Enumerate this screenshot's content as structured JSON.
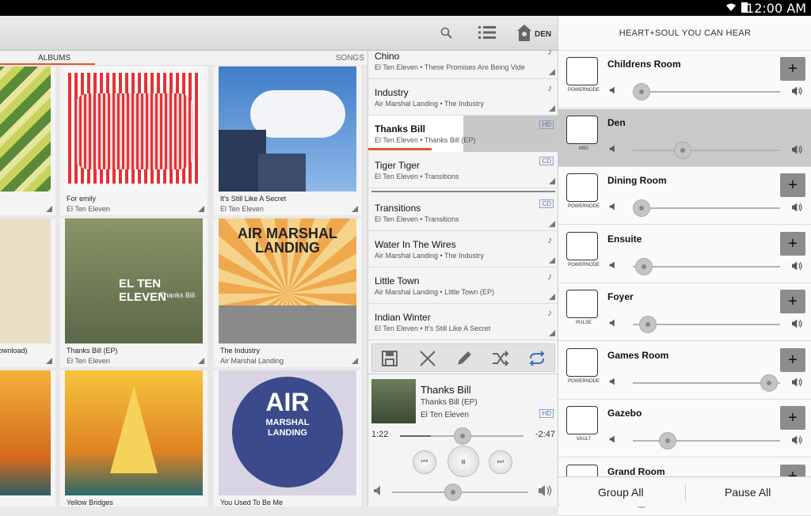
{
  "status": {
    "time": "12:00 AM"
  },
  "topbar": {
    "room_label": "DEN"
  },
  "albums": {
    "tabs": [
      "ALBUMS",
      "SONGS"
    ],
    "items": [
      {
        "title": "",
        "artist": ""
      },
      {
        "title": "For emily",
        "artist": "El Ten Eleven"
      },
      {
        "title": "It's Still Like A Secret",
        "artist": "El Ten Eleven"
      },
      {
        "title": "ownload)",
        "artist": ""
      },
      {
        "title": "Thanks Bill (EP)",
        "artist": "El Ten Eleven"
      },
      {
        "title": "The Industry",
        "artist": "Air Marshal Landing"
      },
      {
        "title": "",
        "artist": ""
      },
      {
        "title": "Yellow Bridges",
        "artist": ""
      },
      {
        "title": "You Used To Be Me",
        "artist": ""
      }
    ],
    "art_text": {
      "air_marshal": "AIR MARSHAL LANDING",
      "el_ten_eleven": "EL TEN ELEVEN",
      "thanks_bill": "Thanks Bill",
      "air_big": "AIR",
      "marshal_landing": "MARSHAL LANDING"
    }
  },
  "queue": {
    "items": [
      {
        "title": "Chino",
        "subtitle": "El Ten Eleven • These Promises Are Being Vide",
        "tag": "♪"
      },
      {
        "title": "Industry",
        "subtitle": "Air Marshal Landing • The Industry",
        "tag": "♪"
      },
      {
        "title": "Thanks Bill",
        "subtitle": "El Ten Eleven • Thanks Bill (EP)",
        "tag": "HD"
      },
      {
        "title": "Tiger Tiger",
        "subtitle": "El Ten Eleven • Transitions",
        "tag": "CD"
      },
      {
        "title": "Transitions",
        "subtitle": "El Ten Eleven • Transitions",
        "tag": "CD"
      },
      {
        "title": "Water In The Wires",
        "subtitle": "Air Marshal Landing • The Industry",
        "tag": "♪"
      },
      {
        "title": "Little Town",
        "subtitle": "Air Marshal Landing • Little Town (EP)",
        "tag": "♪"
      },
      {
        "title": "Indian Winter",
        "subtitle": "El Ten Eleven • It's Still Like A Secret",
        "tag": "♪"
      }
    ]
  },
  "now_playing": {
    "title": "Thanks Bill",
    "album": "Thanks Bill (EP)",
    "artist": "El Ten Eleven",
    "badge": "HD",
    "elapsed": "1:22",
    "remaining": "-2:47",
    "progress": 0.25,
    "volume": 0.27
  },
  "zones": {
    "header": "HEART+SOUL YOU CAN HEAR",
    "items": [
      {
        "name": "Childrens Room",
        "device": "POWERNODE",
        "volume": 0.0,
        "selected": false
      },
      {
        "name": "Den",
        "device": "M50",
        "volume": 0.32,
        "selected": true
      },
      {
        "name": "Dining Room",
        "device": "POWERNODE",
        "volume": 0.0,
        "selected": false
      },
      {
        "name": "Ensuite",
        "device": "POWERNODE",
        "volume": 0.02,
        "selected": false
      },
      {
        "name": "Foyer",
        "device": "PULSE",
        "volume": 0.05,
        "selected": false
      },
      {
        "name": "Games Room",
        "device": "POWERNODE",
        "volume": 0.98,
        "selected": false
      },
      {
        "name": "Gazebo",
        "device": "VAULT",
        "volume": 0.2,
        "selected": false
      },
      {
        "name": "Grand Room",
        "device": "",
        "volume": 0.0,
        "selected": false
      }
    ],
    "footer": {
      "group_all": "Group All",
      "pause_all": "Pause All"
    }
  },
  "colors": {
    "accent": "#e2562c",
    "selected_zone": "#c9c9c9",
    "badge": "#5570a8"
  }
}
